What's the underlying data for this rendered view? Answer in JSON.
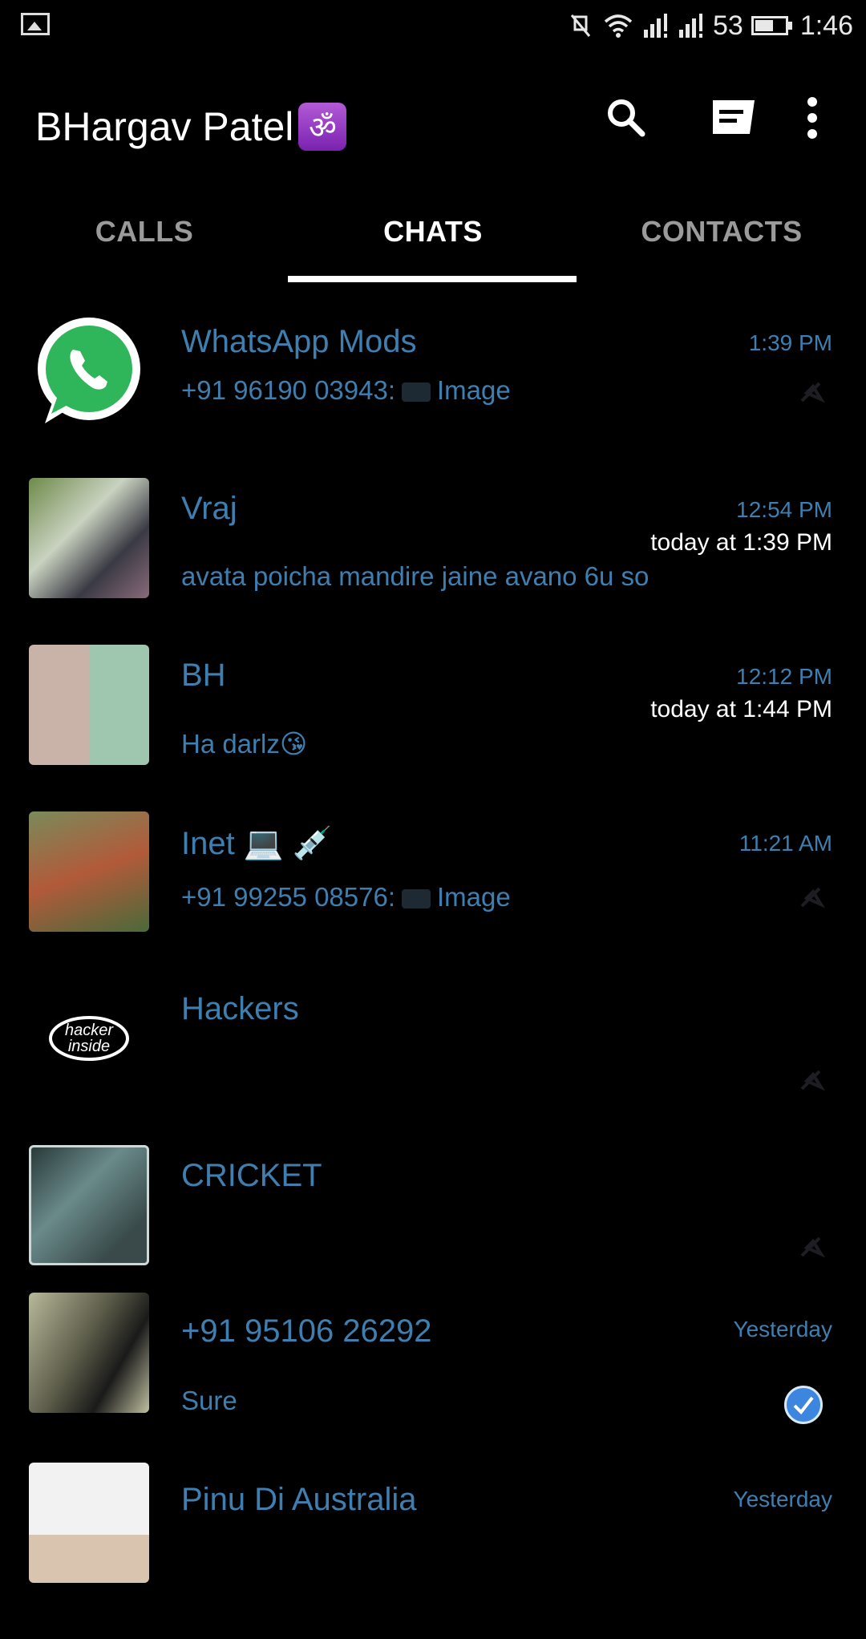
{
  "status_bar": {
    "icons": [
      "gallery-icon",
      "mute-icon",
      "wifi-icon",
      "signal-icon",
      "signal-icon",
      "battery-icon"
    ],
    "battery_level": "53",
    "time": "1:46"
  },
  "header": {
    "title": "BHargav Patel",
    "title_emoji": "ॐ",
    "actions": [
      "search-icon",
      "new-chat-icon",
      "more-vert-icon"
    ]
  },
  "tabs": [
    {
      "label": "CALLS",
      "active": false
    },
    {
      "label": "CHATS",
      "active": true
    },
    {
      "label": "CONTACTS",
      "active": false
    }
  ],
  "colors": {
    "accent": "#3f7fb0",
    "background": "#000000",
    "whatsapp_green": "#2fb55a"
  },
  "chats": [
    {
      "name": "WhatsApp Mods",
      "time": "1:39 PM",
      "sender": "+91 96190 03943:",
      "preview": "Image",
      "notification": ""
    },
    {
      "name": "Vraj",
      "time": "12:54 PM",
      "sender": "",
      "preview": "avata poicha mandire jaine avano 6u so",
      "notification": "today at 1:39 PM"
    },
    {
      "name": "BH",
      "time": "12:12 PM",
      "sender": "",
      "preview": "Ha darlz😘",
      "notification": "today at 1:44 PM"
    },
    {
      "name": "Inet 💻 💉",
      "time": "11:21 AM",
      "sender": "+91 99255 08576:",
      "preview": "Image",
      "notification": ""
    },
    {
      "name": "Hackers",
      "time": "",
      "sender": "",
      "preview": "",
      "notification": "",
      "avatar_text": "hacker inside"
    },
    {
      "name": "CRICKET",
      "time": "",
      "sender": "",
      "preview": "",
      "notification": ""
    },
    {
      "name": "+91 95106 26292",
      "time": "Yesterday",
      "sender": "",
      "preview": "Sure",
      "notification": ""
    },
    {
      "name": "Pinu Di Australia",
      "time": "Yesterday",
      "sender": "",
      "preview": "",
      "notification": ""
    }
  ]
}
